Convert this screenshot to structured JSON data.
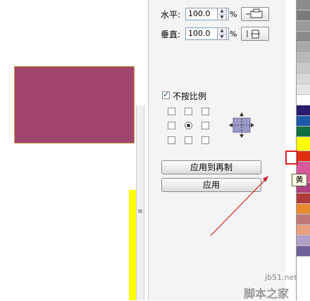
{
  "scale": {
    "horizontal_label": "水平:",
    "horizontal_value": "100.0",
    "vertical_label": "垂直:",
    "vertical_value": "100.0",
    "percent": "%"
  },
  "mirror": {
    "horizontal_icon": "mirror-horizontal-icon",
    "vertical_icon": "mirror-vertical-icon"
  },
  "proportional": {
    "label": "不按比例",
    "checked": true
  },
  "anchor": {
    "selected": "center",
    "preview_icon": "anchor-preview-icon"
  },
  "buttons": {
    "apply_to_duplicate": "应用到再制",
    "apply": "应用"
  },
  "palette": {
    "tooltip": "黄",
    "colors": [
      "#8c8c8c",
      "#7a7a7a",
      "#9a9a9a",
      "#8a8a8a",
      "#a8a8a8",
      "#b8b8b8",
      "#c8c8c8",
      "#d8d8d8",
      "#e4e4e4",
      "#ffffff",
      "#2a1a6e",
      "#1e5aa8",
      "#107040",
      "#ffff00",
      "#e03010",
      "#d85a9a",
      "#b04080",
      "#b03a3a",
      "#e88a30",
      "#c07878",
      "#e8a080",
      "#b0a0c8",
      "#70609a"
    ]
  },
  "colors": {
    "shape_fill": "#a0466e",
    "yellow": "#ffff00",
    "arrow": "#cc2020"
  },
  "watermark": {
    "line1": "jb51.net",
    "line2": "脚本之家"
  }
}
